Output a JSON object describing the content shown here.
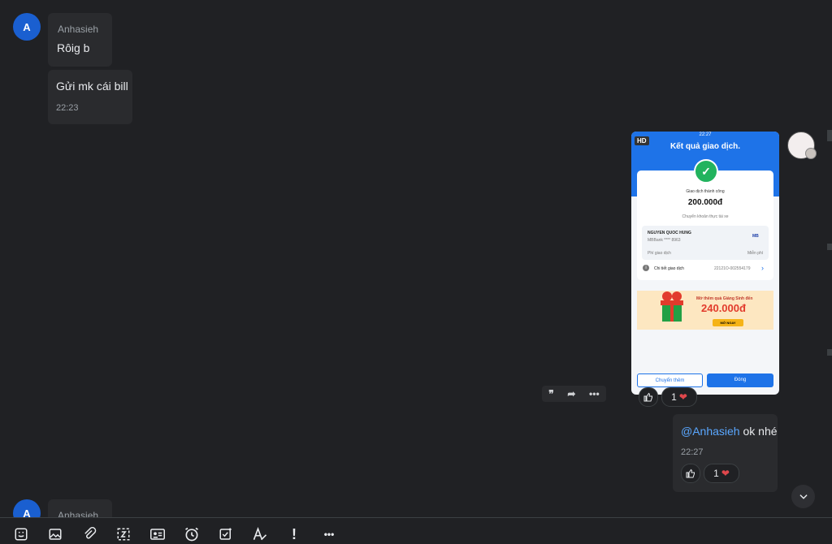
{
  "messages": {
    "first_sender": {
      "initial": "A",
      "name": "Anhasieh"
    },
    "msg1": "Rôig b",
    "msg2": "Gửi mk cái bill",
    "msg2_time": "22:23",
    "bottom_sender": {
      "initial": "A",
      "name": "Anhasieh"
    }
  },
  "image_message": {
    "hd_badge": "HD",
    "status_time": "22:27",
    "title": "Kết quả giao dịch.",
    "status_text": "Giao dịch thành công",
    "amount": "200.000đ",
    "note": "Chuyển khoản thực tài xe",
    "account_name": "NGUYEN QUOC HUNG",
    "account_number": "MBBank **** 8963",
    "bank_logo": "MB",
    "fee_label": "Phí giao dịch",
    "fee_value": "Miễn phí",
    "detail_label": "Chi tiết giao dịch",
    "detail_value": "22121O-002554179",
    "promo_text": "Mở thêm quà Giáng Sinh đến",
    "promo_amount": "240.000đ",
    "promo_button": "MỞ NGAY",
    "btn_transfer": "Chuyển thêm",
    "btn_close": "Đóng",
    "reaction_count": "1"
  },
  "my_message": {
    "mention": "@Anhasieh",
    "text": " ok nhé",
    "time": "22:27",
    "reaction_count": "1"
  },
  "colors": {
    "accent": "#1e73e8",
    "avatar": "#1a5fd0",
    "heart": "#e0474c",
    "mention": "#5aa7ff"
  },
  "icons": [
    "quote-icon",
    "forward-icon",
    "more-icon",
    "like-icon",
    "heart-icon",
    "chevron-down-icon",
    "sticker-icon",
    "image-icon",
    "attach-icon",
    "screenshot-icon",
    "contact-card-icon",
    "reminder-icon",
    "task-icon",
    "format-icon",
    "urgent-icon",
    "more-options-icon"
  ],
  "toolbar": {
    "urgent": "!",
    "more": "•••"
  }
}
